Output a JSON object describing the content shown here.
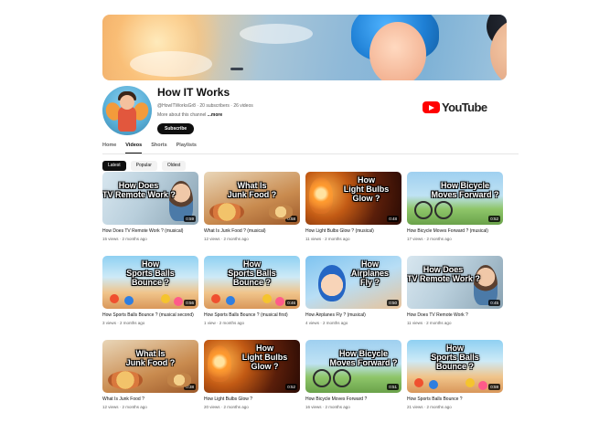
{
  "channel": {
    "name": "How IT Works",
    "handle_meta": "@HowITWorksGr8 · 20 subscribers · 26 videos",
    "about": "More about this channel",
    "more": "...more",
    "subscribe_label": "Subscribe"
  },
  "logo": {
    "word": "YouTube",
    "colors": {
      "red": "#ff0000"
    }
  },
  "tabs": [
    {
      "label": "Home",
      "active": false
    },
    {
      "label": "Videos",
      "active": true
    },
    {
      "label": "Shorts",
      "active": false
    },
    {
      "label": "Playlists",
      "active": false
    }
  ],
  "chips": [
    {
      "label": "Latest",
      "active": true
    },
    {
      "label": "Popular",
      "active": false
    },
    {
      "label": "Oldest",
      "active": false
    }
  ],
  "videos": [
    {
      "theme": "t-tv",
      "thumb_text": "How Does\nTV Remote Work ?",
      "duration": "0:59",
      "title": "How Does TV Remote Work ? (musical)",
      "meta": "15 views · 2 months ago"
    },
    {
      "theme": "t-food",
      "thumb_text": "What Is\nJunk Food ?",
      "duration": "0:58",
      "title": "What Is Junk Food ? (musical)",
      "meta": "12 views · 2 months ago"
    },
    {
      "theme": "t-bulb",
      "thumb_text": "How\nLight Bulbs\nGlow ?",
      "duration": "0:48",
      "title": "How Light Bulbs Glow ? (musical)",
      "meta": "11 views · 2 months ago"
    },
    {
      "theme": "t-bike",
      "thumb_text": "How Bicycle\nMoves Forward ?",
      "duration": "0:52",
      "title": "How Bicycle Moves Forward ? (musical)",
      "meta": "17 views · 2 months ago"
    },
    {
      "theme": "t-ball",
      "thumb_text": "How\nSports Balls\nBounce ?",
      "duration": "0:56",
      "title": "How Sports Balls Bounce ? (musical second)",
      "meta": "3 views · 2 months ago"
    },
    {
      "theme": "t-ball",
      "thumb_text": "How\nSports Balls\nBounce ?",
      "duration": "0:46",
      "title": "How Sports Balls Bounce ? (musical first)",
      "meta": "1 view · 2 months ago"
    },
    {
      "theme": "t-air",
      "thumb_text": "How\nAirplanes\nFly ?",
      "duration": "0:50",
      "title": "How Airplanes Fly ? (musical)",
      "meta": "4 views · 2 months ago"
    },
    {
      "theme": "t-tv",
      "thumb_text": "How Does\nTV Remote Work ?",
      "duration": "0:45",
      "title": "How Does TV Remote Work ?",
      "meta": "11 views · 2 months ago"
    },
    {
      "theme": "t-food",
      "thumb_text": "What Is\nJunk Food ?",
      "duration": "0:38",
      "title": "What Is Junk Food ?",
      "meta": "12 views · 2 months ago"
    },
    {
      "theme": "t-bulb",
      "thumb_text": "How\nLight Bulbs\nGlow ?",
      "duration": "0:52",
      "title": "How Light Bulbs Glow ?",
      "meta": "20 views · 2 months ago"
    },
    {
      "theme": "t-bike",
      "thumb_text": "How Bicycle\nMoves Forward ?",
      "duration": "0:51",
      "title": "How Bicycle Moves Forward ?",
      "meta": "16 views · 2 months ago"
    },
    {
      "theme": "t-ball",
      "thumb_text": "How\nSports Balls\nBounce ?",
      "duration": "0:59",
      "title": "How Sports Balls Bounce ?",
      "meta": "21 views · 2 months ago"
    }
  ]
}
